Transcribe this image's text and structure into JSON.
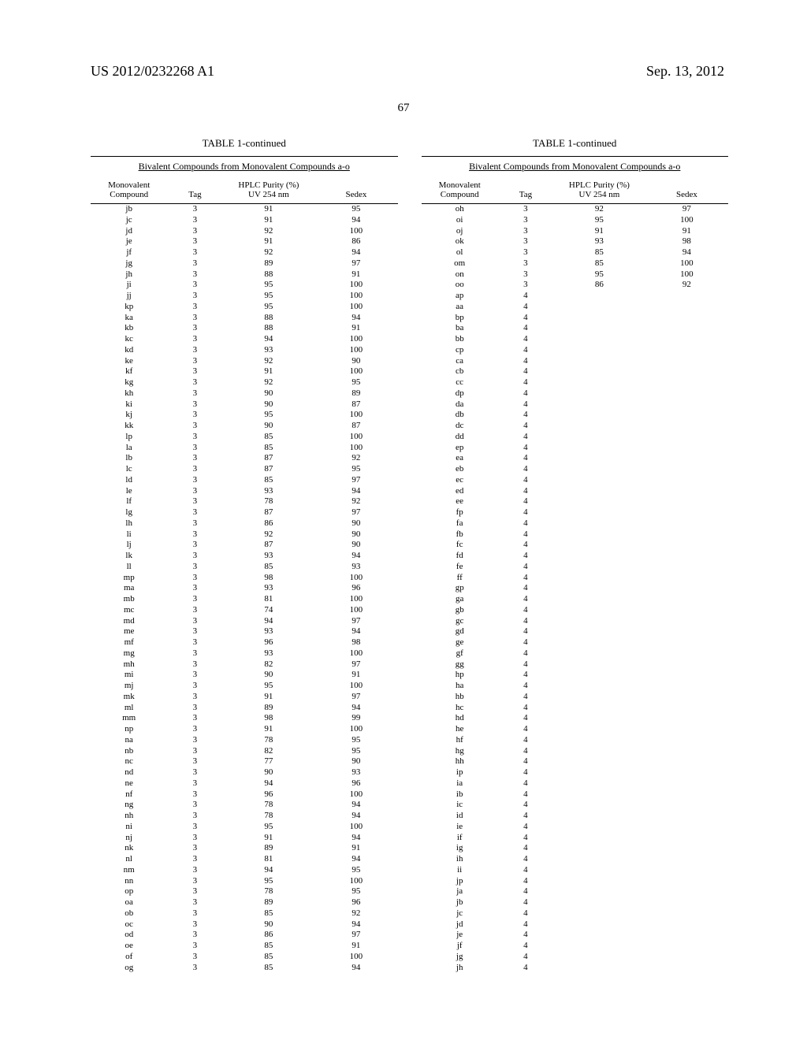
{
  "header": {
    "left": "US 2012/0232268 A1",
    "right": "Sep. 13, 2012"
  },
  "page_num": "67",
  "table_title": "TABLE 1-continued",
  "table_subtitle": "Bivalent Compounds from Monovalent Compounds a-o",
  "col_headers": {
    "compound": "Monovalent\nCompound",
    "tag": "Tag",
    "hplc": "HPLC Purity (%)\nUV 254 nm",
    "sedex": "Sedex"
  },
  "left_rows": [
    [
      "jb",
      "3",
      "91",
      "95"
    ],
    [
      "jc",
      "3",
      "91",
      "94"
    ],
    [
      "jd",
      "3",
      "92",
      "100"
    ],
    [
      "je",
      "3",
      "91",
      "86"
    ],
    [
      "jf",
      "3",
      "92",
      "94"
    ],
    [
      "jg",
      "3",
      "89",
      "97"
    ],
    [
      "jh",
      "3",
      "88",
      "91"
    ],
    [
      "ji",
      "3",
      "95",
      "100"
    ],
    [
      "jj",
      "3",
      "95",
      "100"
    ],
    [
      "kp",
      "3",
      "95",
      "100"
    ],
    [
      "ka",
      "3",
      "88",
      "94"
    ],
    [
      "kb",
      "3",
      "88",
      "91"
    ],
    [
      "kc",
      "3",
      "94",
      "100"
    ],
    [
      "kd",
      "3",
      "93",
      "100"
    ],
    [
      "ke",
      "3",
      "92",
      "90"
    ],
    [
      "kf",
      "3",
      "91",
      "100"
    ],
    [
      "kg",
      "3",
      "92",
      "95"
    ],
    [
      "kh",
      "3",
      "90",
      "89"
    ],
    [
      "ki",
      "3",
      "90",
      "87"
    ],
    [
      "kj",
      "3",
      "95",
      "100"
    ],
    [
      "kk",
      "3",
      "90",
      "87"
    ],
    [
      "lp",
      "3",
      "85",
      "100"
    ],
    [
      "la",
      "3",
      "85",
      "100"
    ],
    [
      "lb",
      "3",
      "87",
      "92"
    ],
    [
      "lc",
      "3",
      "87",
      "95"
    ],
    [
      "ld",
      "3",
      "85",
      "97"
    ],
    [
      "le",
      "3",
      "93",
      "94"
    ],
    [
      "lf",
      "3",
      "78",
      "92"
    ],
    [
      "lg",
      "3",
      "87",
      "97"
    ],
    [
      "lh",
      "3",
      "86",
      "90"
    ],
    [
      "li",
      "3",
      "92",
      "90"
    ],
    [
      "lj",
      "3",
      "87",
      "90"
    ],
    [
      "lk",
      "3",
      "93",
      "94"
    ],
    [
      "ll",
      "3",
      "85",
      "93"
    ],
    [
      "mp",
      "3",
      "98",
      "100"
    ],
    [
      "ma",
      "3",
      "93",
      "96"
    ],
    [
      "mb",
      "3",
      "81",
      "100"
    ],
    [
      "mc",
      "3",
      "74",
      "100"
    ],
    [
      "md",
      "3",
      "94",
      "97"
    ],
    [
      "me",
      "3",
      "93",
      "94"
    ],
    [
      "mf",
      "3",
      "96",
      "98"
    ],
    [
      "mg",
      "3",
      "93",
      "100"
    ],
    [
      "mh",
      "3",
      "82",
      "97"
    ],
    [
      "mi",
      "3",
      "90",
      "91"
    ],
    [
      "mj",
      "3",
      "95",
      "100"
    ],
    [
      "mk",
      "3",
      "91",
      "97"
    ],
    [
      "ml",
      "3",
      "89",
      "94"
    ],
    [
      "mm",
      "3",
      "98",
      "99"
    ],
    [
      "np",
      "3",
      "91",
      "100"
    ],
    [
      "na",
      "3",
      "78",
      "95"
    ],
    [
      "nb",
      "3",
      "82",
      "95"
    ],
    [
      "nc",
      "3",
      "77",
      "90"
    ],
    [
      "nd",
      "3",
      "90",
      "93"
    ],
    [
      "ne",
      "3",
      "94",
      "96"
    ],
    [
      "nf",
      "3",
      "96",
      "100"
    ],
    [
      "ng",
      "3",
      "78",
      "94"
    ],
    [
      "nh",
      "3",
      "78",
      "94"
    ],
    [
      "ni",
      "3",
      "95",
      "100"
    ],
    [
      "nj",
      "3",
      "91",
      "94"
    ],
    [
      "nk",
      "3",
      "89",
      "91"
    ],
    [
      "nl",
      "3",
      "81",
      "94"
    ],
    [
      "nm",
      "3",
      "94",
      "95"
    ],
    [
      "nn",
      "3",
      "95",
      "100"
    ],
    [
      "op",
      "3",
      "78",
      "95"
    ],
    [
      "oa",
      "3",
      "89",
      "96"
    ],
    [
      "ob",
      "3",
      "85",
      "92"
    ],
    [
      "oc",
      "3",
      "90",
      "94"
    ],
    [
      "od",
      "3",
      "86",
      "97"
    ],
    [
      "oe",
      "3",
      "85",
      "91"
    ],
    [
      "of",
      "3",
      "85",
      "100"
    ],
    [
      "og",
      "3",
      "85",
      "94"
    ]
  ],
  "right_rows": [
    [
      "oh",
      "3",
      "92",
      "97"
    ],
    [
      "oi",
      "3",
      "95",
      "100"
    ],
    [
      "oj",
      "3",
      "91",
      "91"
    ],
    [
      "ok",
      "3",
      "93",
      "98"
    ],
    [
      "ol",
      "3",
      "85",
      "94"
    ],
    [
      "om",
      "3",
      "85",
      "100"
    ],
    [
      "on",
      "3",
      "95",
      "100"
    ],
    [
      "oo",
      "3",
      "86",
      "92"
    ],
    [
      "ap",
      "4",
      "",
      ""
    ],
    [
      "aa",
      "4",
      "",
      ""
    ],
    [
      "bp",
      "4",
      "",
      ""
    ],
    [
      "ba",
      "4",
      "",
      ""
    ],
    [
      "bb",
      "4",
      "",
      ""
    ],
    [
      "cp",
      "4",
      "",
      ""
    ],
    [
      "ca",
      "4",
      "",
      ""
    ],
    [
      "cb",
      "4",
      "",
      ""
    ],
    [
      "cc",
      "4",
      "",
      ""
    ],
    [
      "dp",
      "4",
      "",
      ""
    ],
    [
      "da",
      "4",
      "",
      ""
    ],
    [
      "db",
      "4",
      "",
      ""
    ],
    [
      "dc",
      "4",
      "",
      ""
    ],
    [
      "dd",
      "4",
      "",
      ""
    ],
    [
      "ep",
      "4",
      "",
      ""
    ],
    [
      "ea",
      "4",
      "",
      ""
    ],
    [
      "eb",
      "4",
      "",
      ""
    ],
    [
      "ec",
      "4",
      "",
      ""
    ],
    [
      "ed",
      "4",
      "",
      ""
    ],
    [
      "ee",
      "4",
      "",
      ""
    ],
    [
      "fp",
      "4",
      "",
      ""
    ],
    [
      "fa",
      "4",
      "",
      ""
    ],
    [
      "fb",
      "4",
      "",
      ""
    ],
    [
      "fc",
      "4",
      "",
      ""
    ],
    [
      "fd",
      "4",
      "",
      ""
    ],
    [
      "fe",
      "4",
      "",
      ""
    ],
    [
      "ff",
      "4",
      "",
      ""
    ],
    [
      "gp",
      "4",
      "",
      ""
    ],
    [
      "ga",
      "4",
      "",
      ""
    ],
    [
      "gb",
      "4",
      "",
      ""
    ],
    [
      "gc",
      "4",
      "",
      ""
    ],
    [
      "gd",
      "4",
      "",
      ""
    ],
    [
      "ge",
      "4",
      "",
      ""
    ],
    [
      "gf",
      "4",
      "",
      ""
    ],
    [
      "gg",
      "4",
      "",
      ""
    ],
    [
      "hp",
      "4",
      "",
      ""
    ],
    [
      "ha",
      "4",
      "",
      ""
    ],
    [
      "hb",
      "4",
      "",
      ""
    ],
    [
      "hc",
      "4",
      "",
      ""
    ],
    [
      "hd",
      "4",
      "",
      ""
    ],
    [
      "he",
      "4",
      "",
      ""
    ],
    [
      "hf",
      "4",
      "",
      ""
    ],
    [
      "hg",
      "4",
      "",
      ""
    ],
    [
      "hh",
      "4",
      "",
      ""
    ],
    [
      "ip",
      "4",
      "",
      ""
    ],
    [
      "ia",
      "4",
      "",
      ""
    ],
    [
      "ib",
      "4",
      "",
      ""
    ],
    [
      "ic",
      "4",
      "",
      ""
    ],
    [
      "id",
      "4",
      "",
      ""
    ],
    [
      "ie",
      "4",
      "",
      ""
    ],
    [
      "if",
      "4",
      "",
      ""
    ],
    [
      "ig",
      "4",
      "",
      ""
    ],
    [
      "ih",
      "4",
      "",
      ""
    ],
    [
      "ii",
      "4",
      "",
      ""
    ],
    [
      "jp",
      "4",
      "",
      ""
    ],
    [
      "ja",
      "4",
      "",
      ""
    ],
    [
      "jb",
      "4",
      "",
      ""
    ],
    [
      "jc",
      "4",
      "",
      ""
    ],
    [
      "jd",
      "4",
      "",
      ""
    ],
    [
      "je",
      "4",
      "",
      ""
    ],
    [
      "jf",
      "4",
      "",
      ""
    ],
    [
      "jg",
      "4",
      "",
      ""
    ],
    [
      "jh",
      "4",
      "",
      ""
    ]
  ]
}
